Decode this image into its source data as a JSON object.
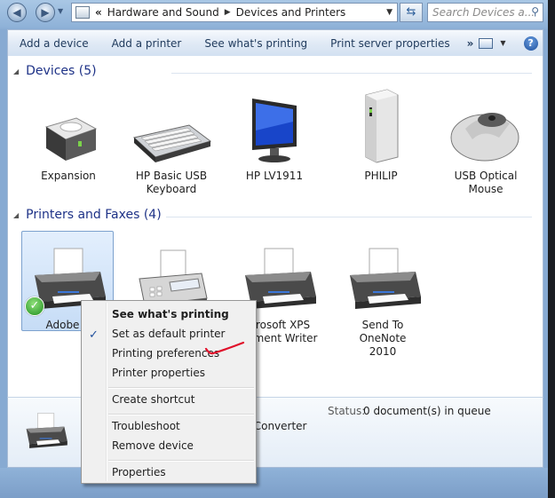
{
  "address": {
    "overflow": "«",
    "crumbs": [
      "Hardware and Sound",
      "Devices and Printers"
    ],
    "search_placeholder": "Search Devices a..."
  },
  "toolbar": {
    "items": [
      "Add a device",
      "Add a printer",
      "See what's printing",
      "Print server properties"
    ],
    "more": "»"
  },
  "devices": {
    "title": "Devices (5)",
    "items": [
      "Expansion",
      "HP Basic USB Keyboard",
      "HP LV1911",
      "PHILIP",
      "USB Optical Mouse"
    ]
  },
  "printers": {
    "title": "Printers and Faxes (4)",
    "items": [
      "Adobe P",
      "",
      "icrosoft XPS\nument Writer",
      "Send To OneNote 2010"
    ]
  },
  "details": {
    "status_label": "Status:",
    "status_value": "0 document(s) in queue",
    "name_line1": "",
    "name_line2": "F Converter"
  },
  "context_menu": {
    "items": [
      "See what's printing",
      "Set as default printer",
      "Printing preferences",
      "Printer properties",
      "Create shortcut",
      "Troubleshoot",
      "Remove device",
      "Properties"
    ]
  },
  "colors": {
    "accent": "#1e3287",
    "selection": "#c6dcf6",
    "annotation": "#e0102a"
  }
}
